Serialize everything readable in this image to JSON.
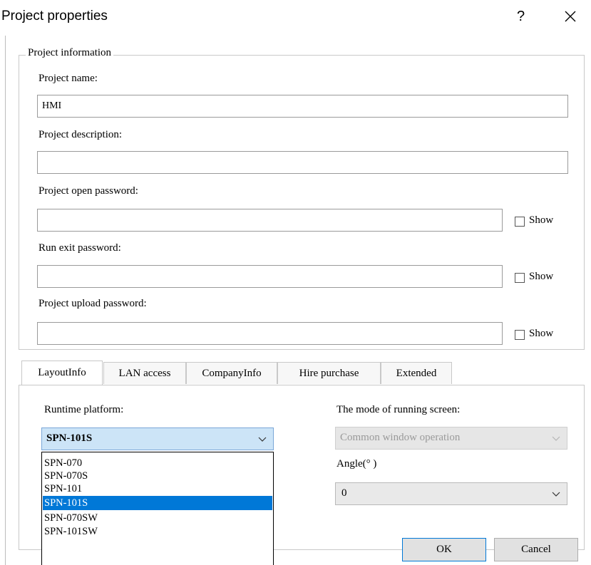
{
  "window": {
    "title": "Project properties",
    "help_label": "?",
    "close_icon": "close-icon"
  },
  "project_info": {
    "legend": "Project information",
    "name_label": "Project name:",
    "name_value": "HMI",
    "desc_label": "Project description:",
    "desc_value": "",
    "open_pw_label": "Project open password:",
    "open_pw_value": "",
    "exit_pw_label": "Run exit password:",
    "exit_pw_value": "",
    "upload_pw_label": "Project upload password:",
    "upload_pw_value": "",
    "show_label": "Show"
  },
  "tabs": [
    "LayoutInfo",
    "LAN access",
    "CompanyInfo",
    "Hire purchase",
    "Extended"
  ],
  "layout": {
    "platform_label": "Runtime platform:",
    "platform_value": "SPN-101S",
    "platform_options": [
      "SPN-070",
      "SPN-070S",
      "SPN-101",
      "SPN-101S",
      "SPN-070SW",
      "SPN-101SW"
    ],
    "platform_selected_index": 3,
    "mode_label": "The mode of running screen:",
    "mode_value": "Common window operation",
    "angle_label": "Angle(° )",
    "angle_value": "0"
  },
  "buttons": {
    "ok": "OK",
    "cancel": "Cancel"
  },
  "colors": {
    "selection": "#0078d7",
    "combo_focus": "#cce4f7"
  }
}
